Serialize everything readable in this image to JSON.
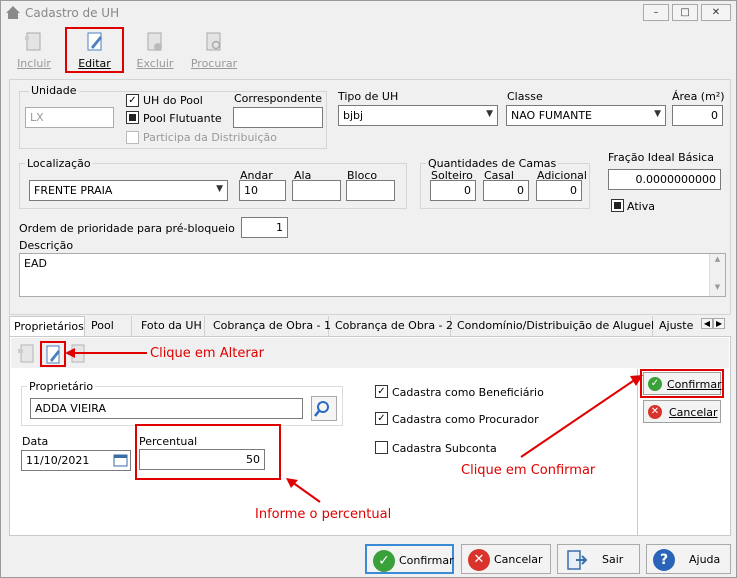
{
  "window": {
    "title": "Cadastro de UH"
  },
  "toolbar": {
    "incluir": "Incluir",
    "editar": "Editar",
    "excluir": "Excluir",
    "procurar": "Procurar"
  },
  "unidade": {
    "label": "Unidade",
    "value": "LX",
    "uh_pool_label": "UH do Pool",
    "pool_flutuante_label": "Pool Flutuante",
    "participa_label": "Participa da Distribuição",
    "correspondente_label": "Correspondente",
    "correspondente_value": ""
  },
  "tipo_uh": {
    "label": "Tipo de UH",
    "value": "bjbj"
  },
  "classe": {
    "label": "Classe",
    "value": "NAO FUMANTE"
  },
  "area": {
    "label": "Área (m²)",
    "value": "0"
  },
  "localizacao": {
    "label": "Localização",
    "value": "FRENTE PRAIA",
    "andar_label": "Andar",
    "andar_value": "10",
    "ala_label": "Ala",
    "ala_value": "",
    "bloco_label": "Bloco",
    "bloco_value": ""
  },
  "camas": {
    "label": "Quantidades de Camas",
    "solteiro_label": "Solteiro",
    "solteiro_value": "0",
    "casal_label": "Casal",
    "casal_value": "0",
    "adicional_label": "Adicional",
    "adicional_value": "0"
  },
  "fracao": {
    "label": "Fração Ideal Básica",
    "value": "0.0000000000",
    "ativa_label": "Ativa"
  },
  "ordem": {
    "label": "Ordem de prioridade para pré-bloqueio",
    "value": "1"
  },
  "descricao": {
    "label": "Descrição",
    "value": "EAD"
  },
  "tabs": [
    "Proprietários",
    "Pool",
    "Foto da UH",
    "Cobrança de Obra - 1",
    "Cobrança de Obra - 2",
    "Condomínio/Distribuição de Aluguel",
    "Ajuste"
  ],
  "proprietarios": {
    "proprietario_label": "Proprietário",
    "proprietario_value": "ADDA VIEIRA",
    "data_label": "Data",
    "data_value": "11/10/2021",
    "percentual_label": "Percentual",
    "percentual_value": "50",
    "beneficiario_label": "Cadastra como Beneficiário",
    "procurador_label": "Cadastra como Procurador",
    "subconta_label": "Cadastra Subconta",
    "confirmar_label": "Confirmar",
    "cancelar_label": "Cancelar"
  },
  "annotations": {
    "alterar": "Clique em Alterar",
    "confirmar": "Clique em Confirmar",
    "percentual": "Informe o percentual"
  },
  "bottom": {
    "confirmar": "Confirmar",
    "cancelar": "Cancelar",
    "sair": "Sair",
    "ajuda": "Ajuda"
  },
  "colors": {
    "accent_red": "#e00000",
    "confirm_green": "#3aa03a",
    "cancel_red": "#d9342b"
  }
}
